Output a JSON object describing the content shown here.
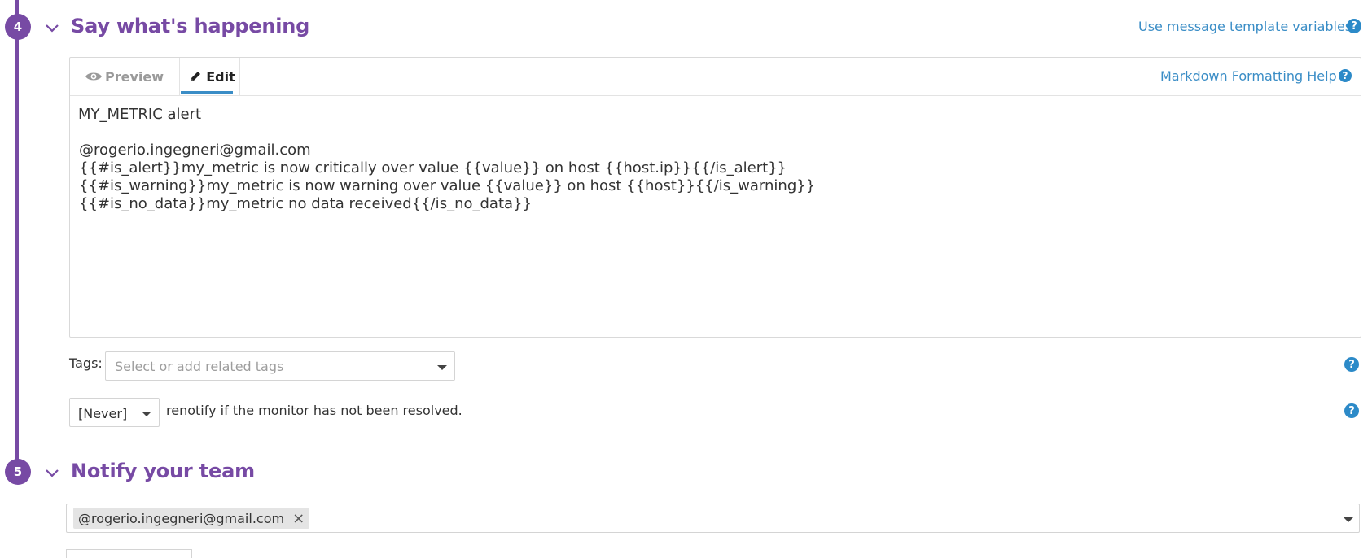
{
  "step4": {
    "number": "4",
    "title": "Say what's happening",
    "template_link": "Use message template variables",
    "tabs": {
      "preview": "Preview",
      "edit": "Edit"
    },
    "markdown_help": "Markdown Formatting Help",
    "title_value": "MY_METRIC alert",
    "body_lines": [
      "@rogerio.ingegneri@gmail.com",
      "{{#is_alert}}my_metric is now critically over value {{value}} on host {{host.ip}}{{/is_alert}}",
      "{{#is_warning}}my_metric is now warning over value {{value}} on host {{host}}{{/is_warning}}",
      "{{#is_no_data}}my_metric no data received{{/is_no_data}}"
    ],
    "tags_label": "Tags:",
    "tags_placeholder": "Select or add related tags",
    "renotify_value": "[Never]",
    "renotify_text": "renotify if the monitor has not been resolved.",
    "help_glyph": "?"
  },
  "step5": {
    "number": "5",
    "title": "Notify your team",
    "recipient_chip": "@rogerio.ingegneri@gmail.com",
    "chip_remove": "×"
  },
  "icons": {
    "preview": "eye-icon",
    "edit": "pencil-icon",
    "collapse": "chevron-down-icon",
    "help": "question-circle-icon"
  },
  "colors": {
    "accent_purple": "#774aa4",
    "link_blue": "#3a8dc6",
    "help_blue": "#2c8ac8"
  }
}
